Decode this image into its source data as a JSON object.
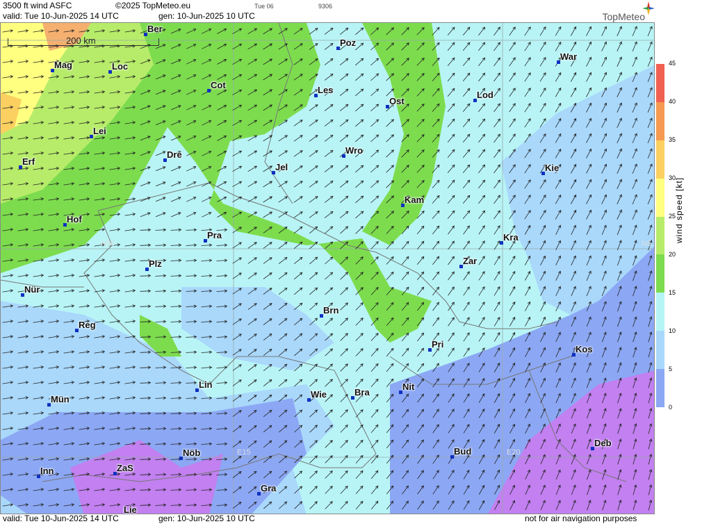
{
  "header": {
    "title": "3500 ft wind ASFC",
    "copyright": "©2025 TopMeteo.eu",
    "tab": "Tue 06",
    "code": "9306",
    "valid": "valid:  Tue  10-Jun-2025  14 UTC",
    "gen": "gen: 10-Jun-2025 10 UTC",
    "brand": "TopMeteo"
  },
  "scale_bar": "200 km",
  "grid_labels": {
    "n50_left": "N50",
    "n50_right": "N5",
    "e15": "E15",
    "e20": "E20"
  },
  "cities": [
    {
      "name": "Ber"
    },
    {
      "name": "Poz"
    },
    {
      "name": "War"
    },
    {
      "name": "Mag"
    },
    {
      "name": "Loc"
    },
    {
      "name": "Cot"
    },
    {
      "name": "Les"
    },
    {
      "name": "Lod"
    },
    {
      "name": "Ost"
    },
    {
      "name": "Lei"
    },
    {
      "name": "Dre"
    },
    {
      "name": "Wro"
    },
    {
      "name": "Jel"
    },
    {
      "name": "Erf"
    },
    {
      "name": "Kie"
    },
    {
      "name": "Kam"
    },
    {
      "name": "Hof"
    },
    {
      "name": "Pra"
    },
    {
      "name": "Kra"
    },
    {
      "name": "Plz"
    },
    {
      "name": "Zar"
    },
    {
      "name": "Nür"
    },
    {
      "name": "Brn"
    },
    {
      "name": "Reg"
    },
    {
      "name": "Pri"
    },
    {
      "name": "Kos"
    },
    {
      "name": "Lin"
    },
    {
      "name": "Nit"
    },
    {
      "name": "Wie"
    },
    {
      "name": "Bra"
    },
    {
      "name": "Mün"
    },
    {
      "name": "Deb"
    },
    {
      "name": "Nöb"
    },
    {
      "name": "Bud"
    },
    {
      "name": "ZaS"
    },
    {
      "name": "Inn"
    },
    {
      "name": "Gra"
    },
    {
      "name": "Lie"
    }
  ],
  "legend": {
    "title": "wind  speed  [kt]",
    "ticks": [
      "45",
      "40",
      "35",
      "30",
      "25",
      "20",
      "15",
      "10",
      "5",
      "0"
    ],
    "colors": [
      "#f06050",
      "#f59a50",
      "#fbd060",
      "#ffff80",
      "#b7ec6a",
      "#7ddc4e",
      "#b5f5f5",
      "#a9d8fb",
      "#8ca8f4",
      "#c280f0"
    ]
  },
  "footer": {
    "valid": "valid:  Tue   10-Jun-2025   14 UTC",
    "gen": "gen: 10-Jun-2025 10 UTC",
    "note": "not for air navigation purposes"
  }
}
